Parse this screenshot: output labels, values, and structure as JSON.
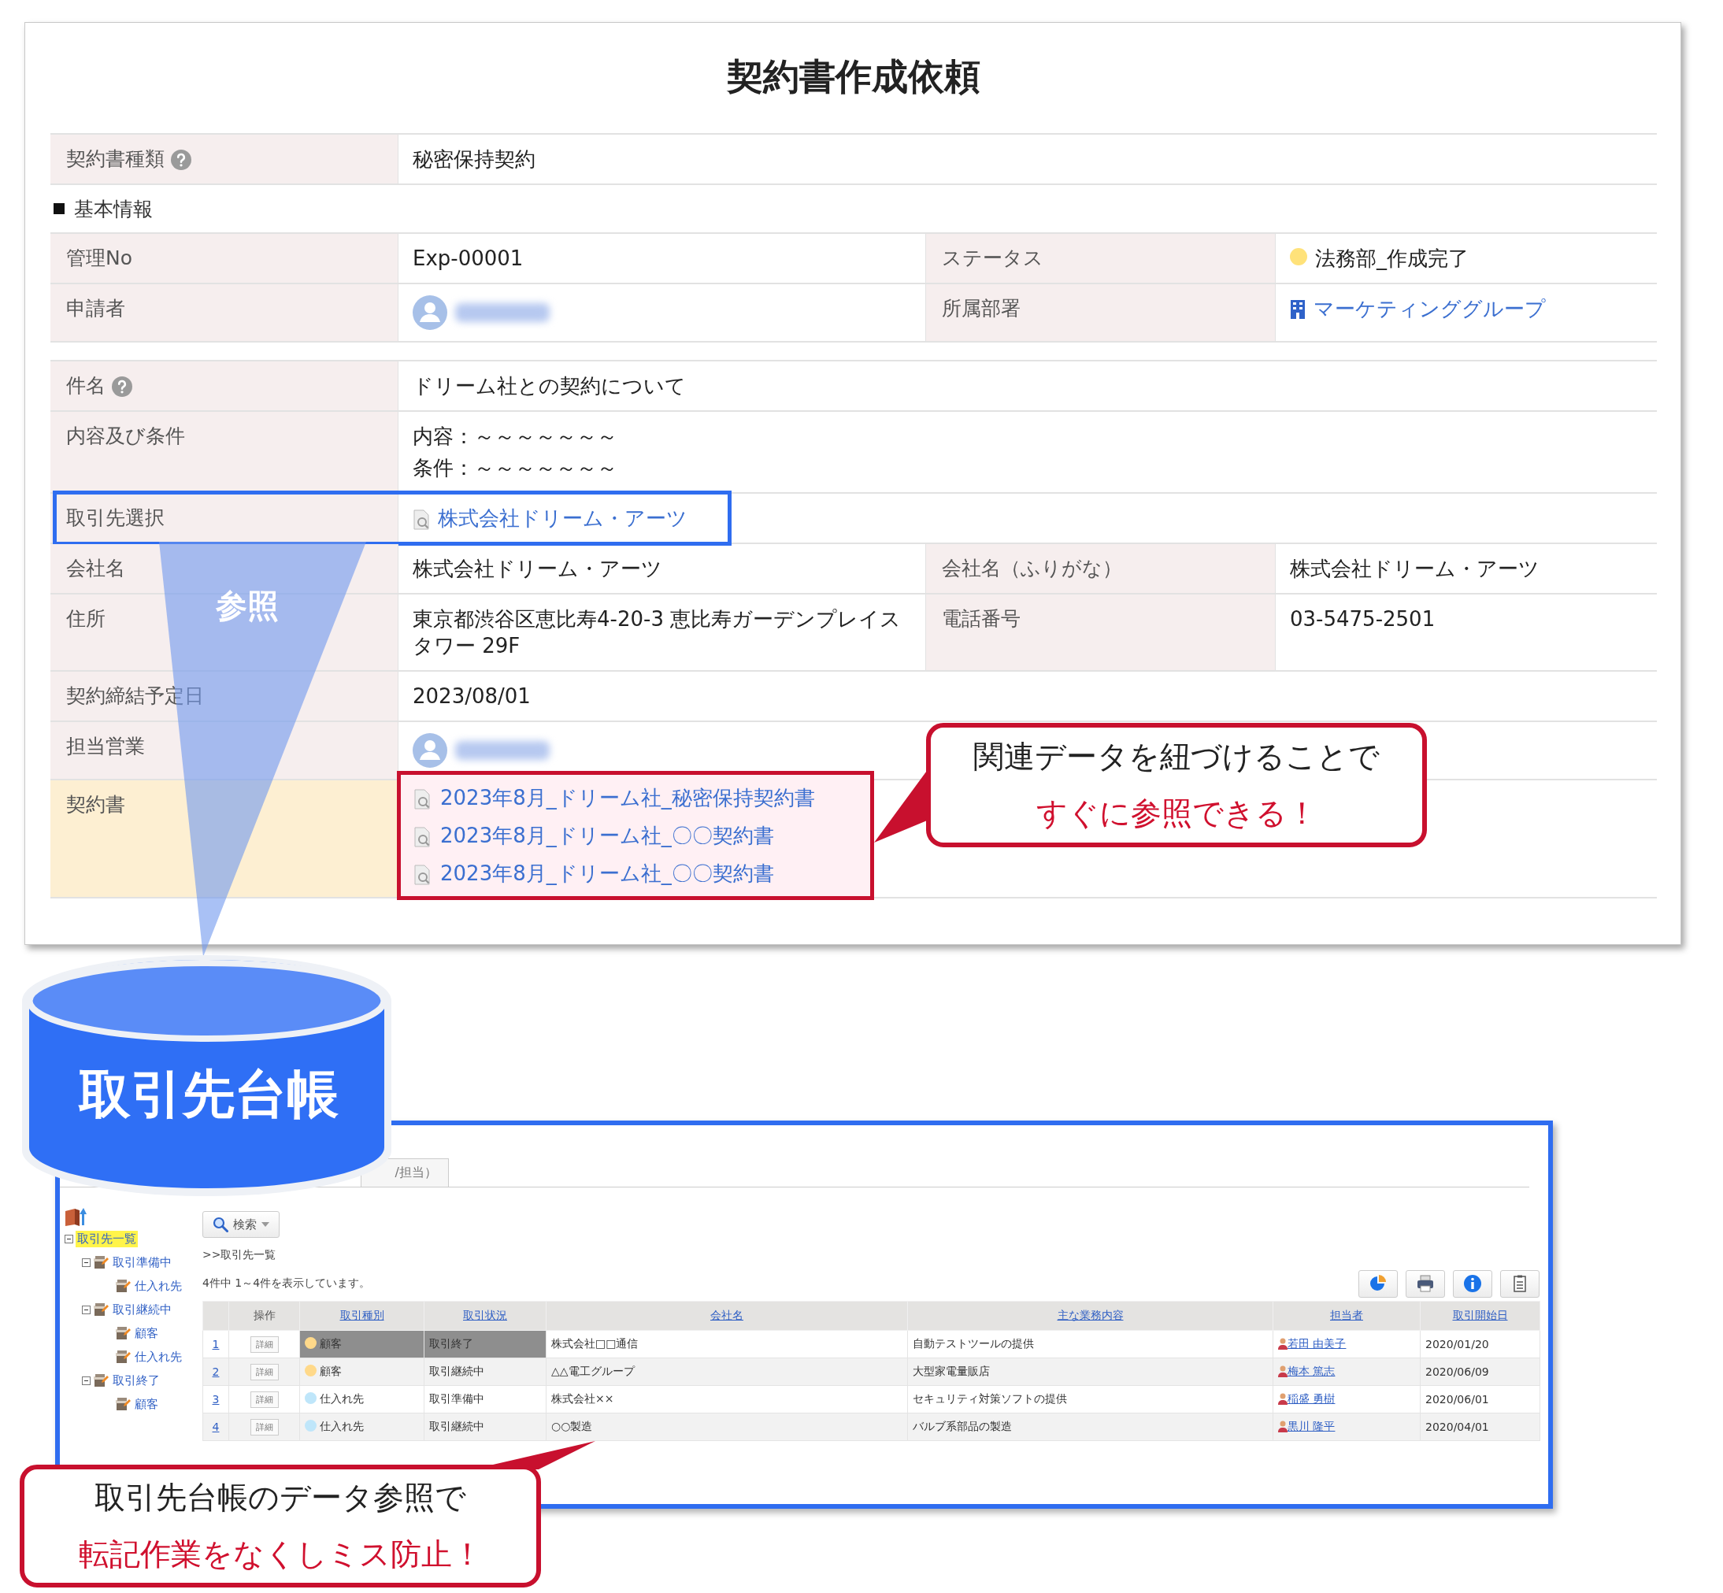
{
  "form": {
    "title": "契約書作成依頼",
    "blocks": [
      {
        "rows": [
          {
            "highlighted": false,
            "fields": [
              {
                "label": "契約書種類",
                "help": true,
                "kind": "text",
                "value": "秘密保持契約"
              }
            ]
          }
        ]
      },
      {
        "heading": "基本情報",
        "rows": [
          {
            "highlighted": false,
            "fields": [
              {
                "label": "管理No",
                "help": false,
                "kind": "text",
                "value": "Exp-00001"
              },
              {
                "label": "ステータス",
                "help": false,
                "kind": "status",
                "value": "法務部_作成完了",
                "color": "#ffe27a"
              }
            ]
          },
          {
            "highlighted": false,
            "fields": [
              {
                "label": "申請者",
                "help": false,
                "kind": "user"
              },
              {
                "label": "所属部署",
                "help": false,
                "kind": "dept",
                "value": "マーケティンググループ"
              }
            ]
          }
        ]
      },
      {
        "rows": [
          {
            "highlighted": false,
            "fields": [
              {
                "label": "件名",
                "help": true,
                "kind": "text",
                "value": "ドリーム社との契約について"
              }
            ]
          },
          {
            "highlighted": false,
            "fields": [
              {
                "label": "内容及び条件",
                "help": false,
                "kind": "lines",
                "values": [
                  "内容：～～～～～～～",
                  "条件：～～～～～～～"
                ]
              }
            ]
          },
          {
            "highlighted": false,
            "fields": [
              {
                "label": "取引先選択",
                "help": false,
                "kind": "link",
                "value": "株式会社ドリーム・アーツ"
              }
            ]
          },
          {
            "highlighted": false,
            "fields": [
              {
                "label": "会社名",
                "help": false,
                "kind": "text",
                "value": "株式会社ドリーム・アーツ"
              },
              {
                "label": "会社名（ふりがな）",
                "help": false,
                "kind": "text",
                "value": "株式会社ドリーム・アーツ"
              }
            ]
          },
          {
            "highlighted": false,
            "fields": [
              {
                "label": "住所",
                "help": false,
                "kind": "text",
                "value": "東京都渋谷区恵比寿4-20-3 恵比寿ガーデンプレイスタワー 29F"
              },
              {
                "label": "電話番号",
                "help": false,
                "kind": "text",
                "value": "03-5475-2501"
              }
            ]
          },
          {
            "highlighted": false,
            "fields": [
              {
                "label": "契約締結予定日",
                "help": false,
                "kind": "text",
                "value": "2023/08/01"
              }
            ]
          },
          {
            "highlighted": false,
            "fields": [
              {
                "label": "担当営業",
                "help": false,
                "kind": "user"
              }
            ]
          },
          {
            "highlighted": true,
            "fields": [
              {
                "label": "契約書",
                "help": false,
                "kind": "files",
                "values": [
                  "2023年8月_ドリーム社_秘密保持契約書",
                  "2023年8月_ドリーム社_〇〇契約書",
                  "2023年8月_ドリーム社_〇〇契約書"
                ]
              }
            ]
          }
        ]
      }
    ]
  },
  "annotations": {
    "reference_label": "参照",
    "database_label": "取引先台帳",
    "callouts": [
      {
        "lines": [
          {
            "text": "関連データを紐づけることで",
            "emphasis": false
          },
          {
            "text": "すぐに参照できる！",
            "emphasis": true
          }
        ]
      },
      {
        "lines": [
          {
            "text": "取引先台帳のデータ参照で",
            "emphasis": false
          },
          {
            "text": "転記作業をなくしミス防止！",
            "emphasis": true
          }
        ]
      }
    ]
  },
  "ledger": {
    "tab": "/担当）",
    "tree": {
      "label": "取引先一覧",
      "selected": true,
      "expanded": true,
      "children": [
        {
          "label": "取引準備中",
          "selected": false,
          "expanded": true,
          "children": [
            {
              "label": "仕入れ先",
              "selected": false
            }
          ]
        },
        {
          "label": "取引継続中",
          "selected": false,
          "expanded": true,
          "children": [
            {
              "label": "顧客",
              "selected": false
            },
            {
              "label": "仕入れ先",
              "selected": false
            }
          ]
        },
        {
          "label": "取引終了",
          "selected": false,
          "expanded": true,
          "children": [
            {
              "label": "顧客",
              "selected": false
            }
          ]
        }
      ]
    },
    "search_button": "検索",
    "breadcrumb": ">>取引先一覧",
    "count": "4件中 1～4件を表示しています。",
    "table": {
      "columns": [
        {
          "label": "操作",
          "sortable": false
        },
        {
          "label": "取引種別",
          "sortable": true
        },
        {
          "label": "取引状況",
          "sortable": true
        },
        {
          "label": "会社名",
          "sortable": true
        },
        {
          "label": "主な業務内容",
          "sortable": true
        },
        {
          "label": "担当者",
          "sortable": true
        },
        {
          "label": "取引開始日",
          "sortable": true
        }
      ],
      "rows": [
        {
          "no": "1",
          "action": "詳細",
          "type": "顧客",
          "color": "#ffd98a",
          "status": "取引終了",
          "company": "株式会社□□通信",
          "business": "自動テストツールの提供",
          "person": "若田 由美子",
          "start": "2020/01/20",
          "selected": true
        },
        {
          "no": "2",
          "action": "詳細",
          "type": "顧客",
          "color": "#ffd98a",
          "status": "取引継続中",
          "company": "△△電工グループ",
          "business": "大型家電量販店",
          "person": "梅本 篤志",
          "start": "2020/06/09",
          "selected": false
        },
        {
          "no": "3",
          "action": "詳細",
          "type": "仕入れ先",
          "color": "#bfe6fa",
          "status": "取引準備中",
          "company": "株式会社××",
          "business": "セキュリティ対策ソフトの提供",
          "person": "稲盛 勇樹",
          "start": "2020/06/01",
          "selected": false
        },
        {
          "no": "4",
          "action": "詳細",
          "type": "仕入れ先",
          "color": "#bfe6fa",
          "status": "取引継続中",
          "company": "○○製造",
          "business": "バルブ系部品の製造",
          "person": "黒川 隆平",
          "start": "2020/04/01",
          "selected": false
        }
      ]
    }
  }
}
